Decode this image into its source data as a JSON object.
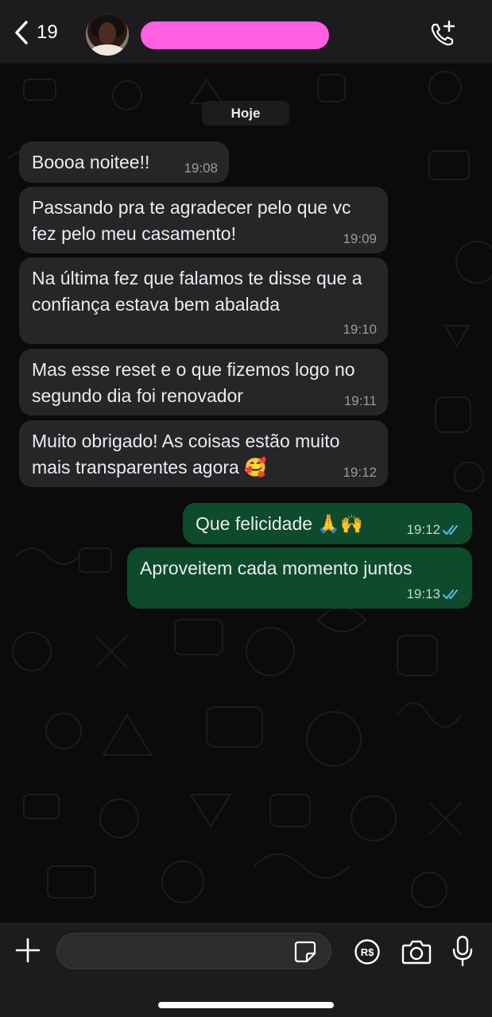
{
  "header": {
    "back_count": "19",
    "icons": {
      "back": "chevron-left-icon",
      "call": "add-call-icon"
    }
  },
  "chat": {
    "date_label": "Hoje",
    "messages": [
      {
        "direction": "in",
        "text": "Boooa noitee!!",
        "time": "19:08"
      },
      {
        "direction": "in",
        "text": "Passando pra te agradecer pelo que vc fez pelo meu casamento!",
        "time": "19:09"
      },
      {
        "direction": "in",
        "text": "Na última fez que falamos te disse que a confiança estava bem abalada",
        "time": "19:10"
      },
      {
        "direction": "in",
        "text": "Mas esse reset e o que fizemos logo no segundo dia foi renovador",
        "time": "19:11"
      },
      {
        "direction": "in",
        "text": "Muito obrigado! As coisas estão muito mais transparentes agora  🥰",
        "time": "19:12"
      },
      {
        "direction": "out",
        "text": "Que felicidade 🙏🙌",
        "time": "19:12",
        "status": "read"
      },
      {
        "direction": "out",
        "text": "Aproveitem cada momento juntos",
        "time": "19:13",
        "status": "read"
      }
    ]
  },
  "input_bar": {
    "message_value": "",
    "icons": [
      "plus-icon",
      "sticker-icon",
      "payment-icon",
      "camera-icon",
      "microphone-icon"
    ]
  },
  "colors": {
    "incoming_bubble": "#262628",
    "outgoing_bubble": "#0e4a2c",
    "read_ticks": "#53bdeb",
    "redaction": "#ff5fe0"
  }
}
